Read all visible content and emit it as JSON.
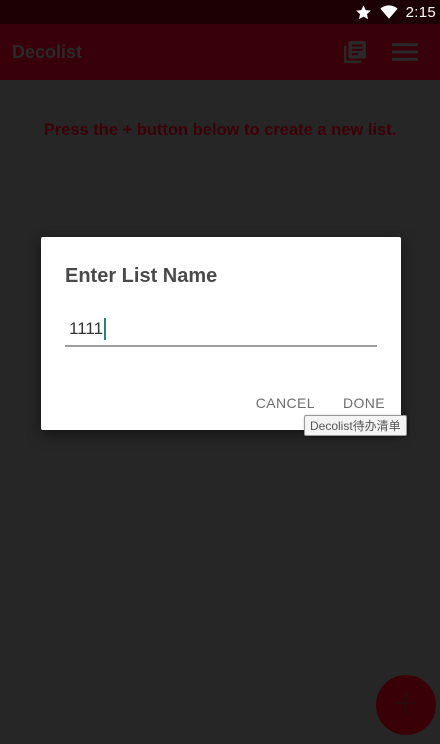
{
  "status_bar": {
    "time": "2:15",
    "icons": [
      "star-icon",
      "wifi-icon"
    ]
  },
  "app_bar": {
    "title": "Decolist",
    "actions": [
      "library-books-icon",
      "menu-icon"
    ]
  },
  "main": {
    "hint": "Press the + button below to create a new list."
  },
  "dialog": {
    "title": "Enter List Name",
    "input_value": "1111",
    "cancel_label": "CANCEL",
    "done_label": "DONE"
  },
  "tooltip": {
    "text": "Decolist待办清单"
  },
  "fab": {
    "icon": "plus-icon"
  },
  "colors": {
    "status_bar_bg": "#1c0004",
    "app_bar_bg": "#380008",
    "accent": "#3a0008",
    "caret": "#2a7f86"
  }
}
